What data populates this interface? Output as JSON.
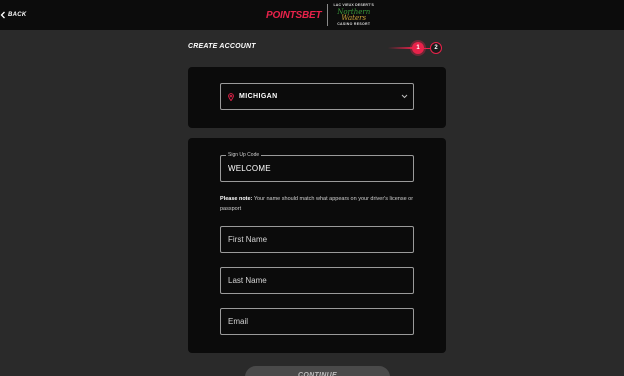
{
  "header": {
    "back_label": "BACK",
    "logo_points": "POINTS",
    "logo_bet": "BET",
    "partner_top": "LAC VIEUX DESERT'S",
    "partner_mid1": "Northern",
    "partner_mid2": "Waters",
    "partner_bottom": "CASINO RESORT"
  },
  "page": {
    "title": "CREATE ACCOUNT",
    "steps": [
      "1",
      "2"
    ],
    "active_step": 1
  },
  "state_select": {
    "value": "MICHIGAN"
  },
  "form": {
    "signup_code_label": "Sign Up Code",
    "signup_code_value": "WELCOME",
    "note_bold": "Please note:",
    "note_text": " Your name should match what appears on your driver's license or passport",
    "first_name_placeholder": "First Name",
    "last_name_placeholder": "Last Name",
    "email_placeholder": "Email",
    "continue_label": "CONTINUE"
  },
  "colors": {
    "accent": "#e8224a",
    "background": "#2a2a2a",
    "card": "#0b0b0b"
  },
  "icons": {
    "back": "chevron-left-icon",
    "location": "map-pin-icon",
    "dropdown": "chevron-down-icon"
  }
}
